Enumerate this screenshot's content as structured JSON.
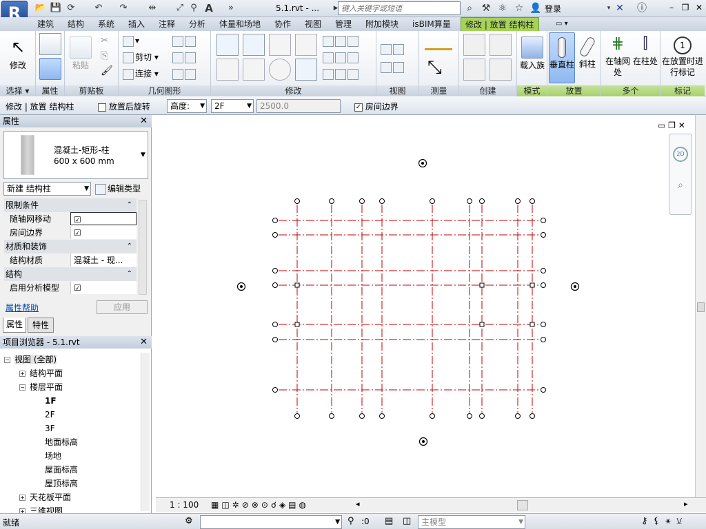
{
  "title_bar": {
    "doc_title": "5.1.rvt - ...",
    "search_placeholder": "键入关键字或短语",
    "login_label": "登录"
  },
  "tabs": [
    "建筑",
    "结构",
    "系统",
    "插入",
    "注释",
    "分析",
    "体量和场地",
    "协作",
    "视图",
    "管理",
    "附加模块",
    "isBIM算量",
    "修改 | 放置 结构柱"
  ],
  "active_tab": "修改 | 放置 结构柱",
  "ribbon": {
    "select": {
      "modify_label": "修改",
      "panel": "选择"
    },
    "properties_panel": "属性",
    "clipboard": {
      "paste_label": "粘贴",
      "panel": "剪贴板"
    },
    "geometry": {
      "cut_label": "剪切",
      "join_label": "连接",
      "panel": "几何图形"
    },
    "modify_panel": "修改",
    "view_panel": "视图",
    "measure_panel": "测量",
    "create_panel": "创建",
    "mode": {
      "load_family": "载入族",
      "panel": "模式"
    },
    "placement": {
      "vertical_column": "垂直柱",
      "slanted_column": "斜柱",
      "panel": "放置"
    },
    "multiple": {
      "at_grids": "在轴网处",
      "at_columns": "在柱处",
      "panel": "多个"
    },
    "tag": {
      "tag_on_place": "在放置时进行标记",
      "panel": "标记"
    }
  },
  "options_bar": {
    "context": "修改 | 放置 结构柱",
    "rotate_after_place": "放置后旋转",
    "height_label": "高度:",
    "level": "2F",
    "value": "2500.0",
    "room_bounding": "房间边界"
  },
  "properties": {
    "title": "属性",
    "type_name_1": "混凝土-矩形-柱",
    "type_name_2": "600 x 600 mm",
    "new_selector": "新建 结构柱",
    "edit_type": "编辑类型",
    "groups": [
      {
        "name": "限制条件",
        "rows": [
          {
            "k": "随轴网移动",
            "v": "☑"
          },
          {
            "k": "房间边界",
            "v": "☑"
          }
        ]
      },
      {
        "name": "材质和装饰",
        "rows": [
          {
            "k": "结构材质",
            "v": "混凝土 - 现..."
          }
        ]
      },
      {
        "name": "结构",
        "rows": [
          {
            "k": "启用分析模型",
            "v": "☑"
          }
        ]
      }
    ],
    "help_link": "属性帮助",
    "apply": "应用",
    "bottom_tabs": [
      "属性",
      "特性"
    ]
  },
  "browser": {
    "title": "项目浏览器 - 5.1.rvt",
    "tree": [
      {
        "label": "视图 (全部)",
        "level": 0,
        "exp": "−"
      },
      {
        "label": "结构平面",
        "level": 1,
        "exp": "+"
      },
      {
        "label": "楼层平面",
        "level": 1,
        "exp": "−"
      },
      {
        "label": "1F",
        "level": 2,
        "bold": true
      },
      {
        "label": "2F",
        "level": 2
      },
      {
        "label": "3F",
        "level": 2
      },
      {
        "label": "地面标高",
        "level": 2
      },
      {
        "label": "场地",
        "level": 2
      },
      {
        "label": "屋面标高",
        "level": 2
      },
      {
        "label": "屋顶标高",
        "level": 2
      },
      {
        "label": "天花板平面",
        "level": 1,
        "exp": "+"
      },
      {
        "label": "三维视图",
        "level": 1,
        "exp": "+"
      }
    ]
  },
  "view_control": {
    "scale": "1 : 100"
  },
  "status_bar": {
    "status": "就绪",
    "select_count": ":0",
    "model": "主模型"
  },
  "colors": {
    "grid_line": "#c00000",
    "active_tab": "#a6d25a",
    "selected_button": "#8fb8ef"
  }
}
